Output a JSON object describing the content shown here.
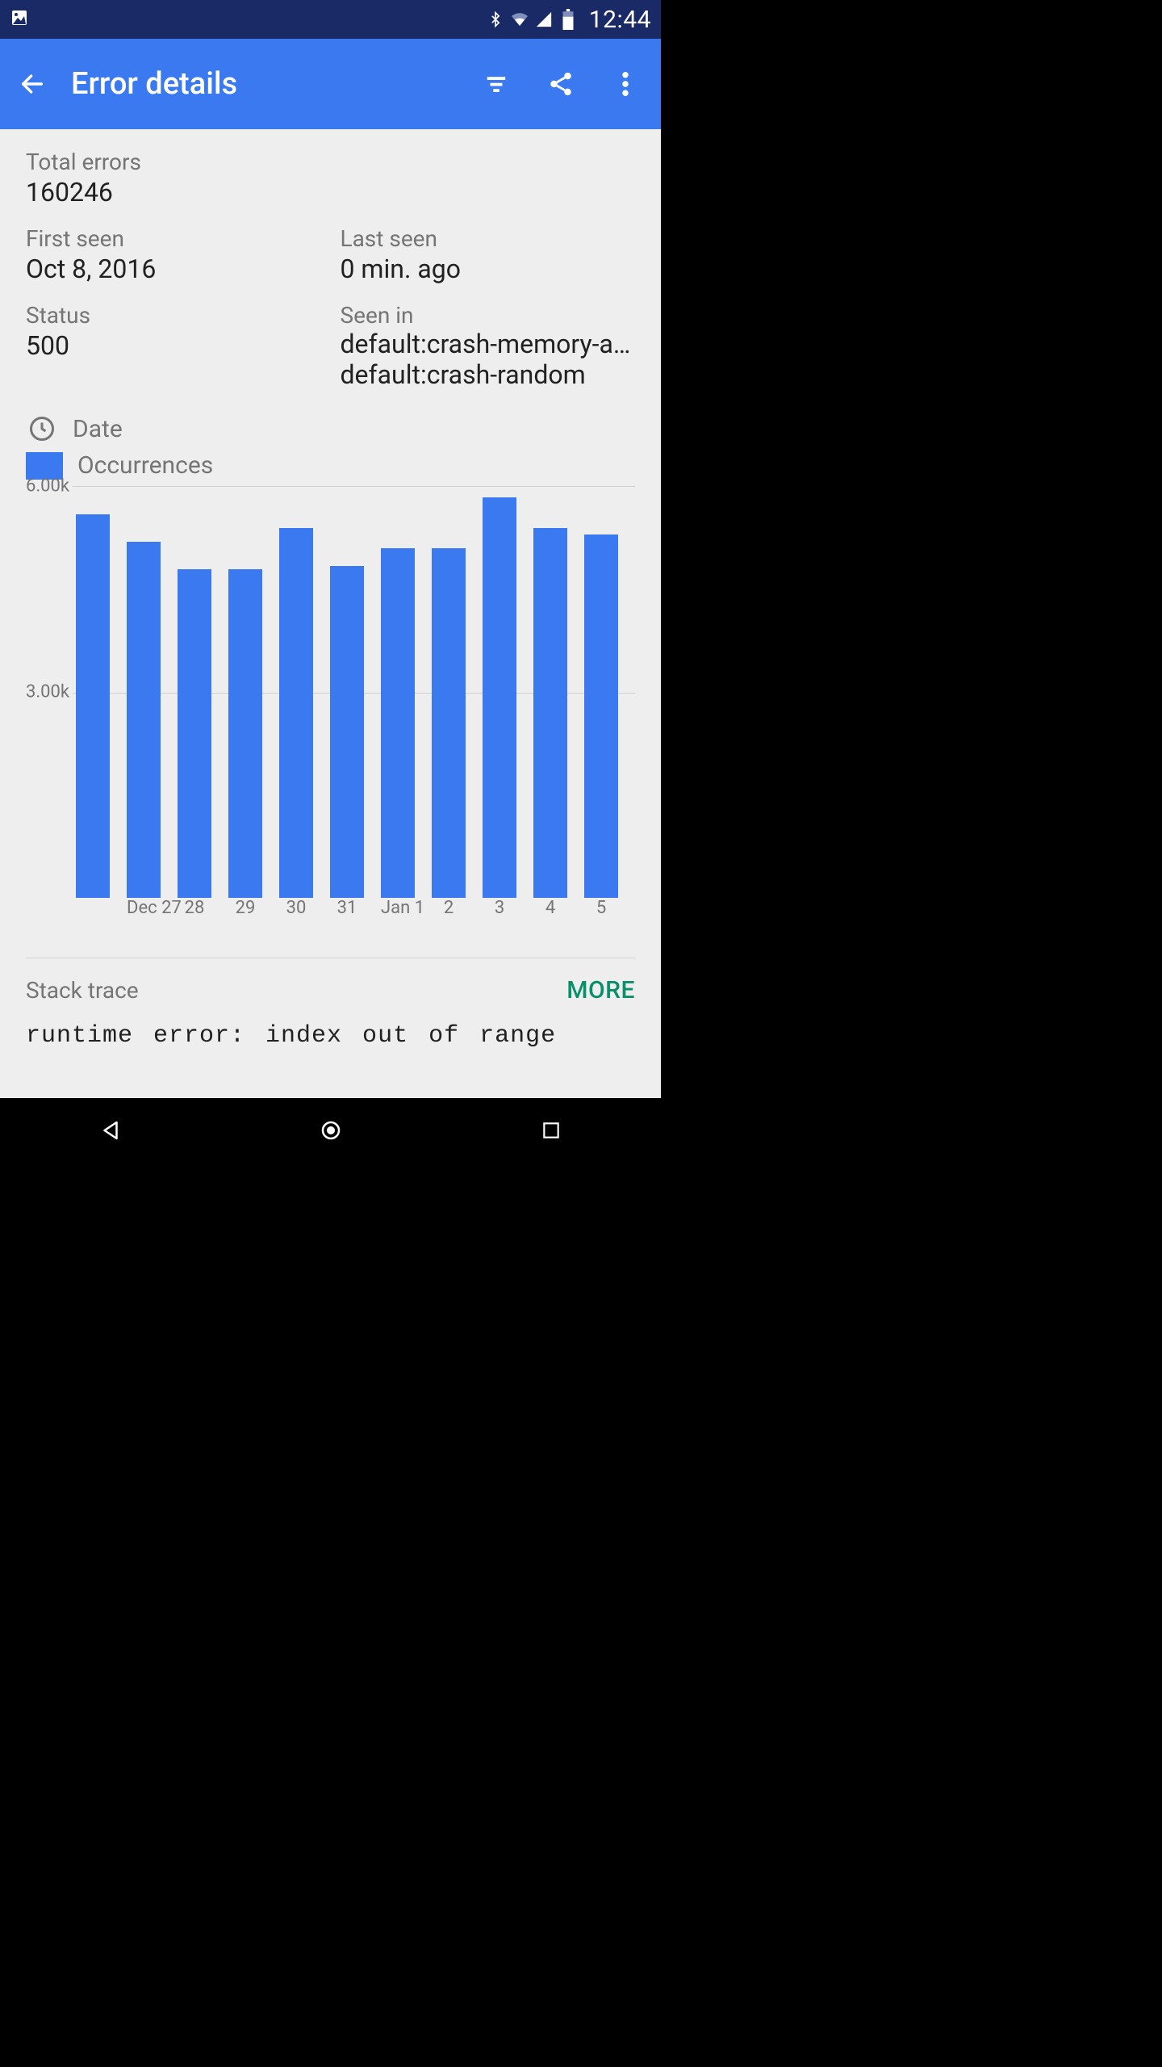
{
  "status_bar": {
    "time": "12:44"
  },
  "app_bar": {
    "title": "Error details"
  },
  "summary": {
    "total_errors": {
      "label": "Total errors",
      "value": "160246"
    },
    "first_seen": {
      "label": "First seen",
      "value": "Oct 8, 2016"
    },
    "last_seen": {
      "label": "Last seen",
      "value": "0 min. ago"
    },
    "status": {
      "label": "Status",
      "value": "500"
    },
    "seen_in": {
      "label": "Seen in",
      "values": [
        "default:crash-memory-acces…",
        "default:crash-random"
      ]
    }
  },
  "legend": {
    "date": "Date",
    "occurrences": "Occurrences"
  },
  "chart_data": {
    "type": "bar",
    "title": "",
    "xlabel": "Date",
    "ylabel": "Occurrences",
    "ylim": [
      0,
      6000
    ],
    "yticks": [
      3000,
      6000
    ],
    "ytick_labels": [
      "3.00k",
      "6.00k"
    ],
    "categories": [
      "",
      "Dec 27",
      "28",
      "29",
      "30",
      "31",
      "Jan 1",
      "2",
      "3",
      "4",
      "5"
    ],
    "values": [
      5600,
      5200,
      4800,
      4800,
      5400,
      4850,
      5100,
      5100,
      5850,
      5400,
      5300
    ]
  },
  "stack_trace": {
    "label": "Stack trace",
    "more": "MORE",
    "text": "runtime error: index out of range"
  },
  "colors": {
    "accent": "#3a79ef",
    "status_bar": "#1a2a66",
    "more": "#0a8f6b"
  }
}
